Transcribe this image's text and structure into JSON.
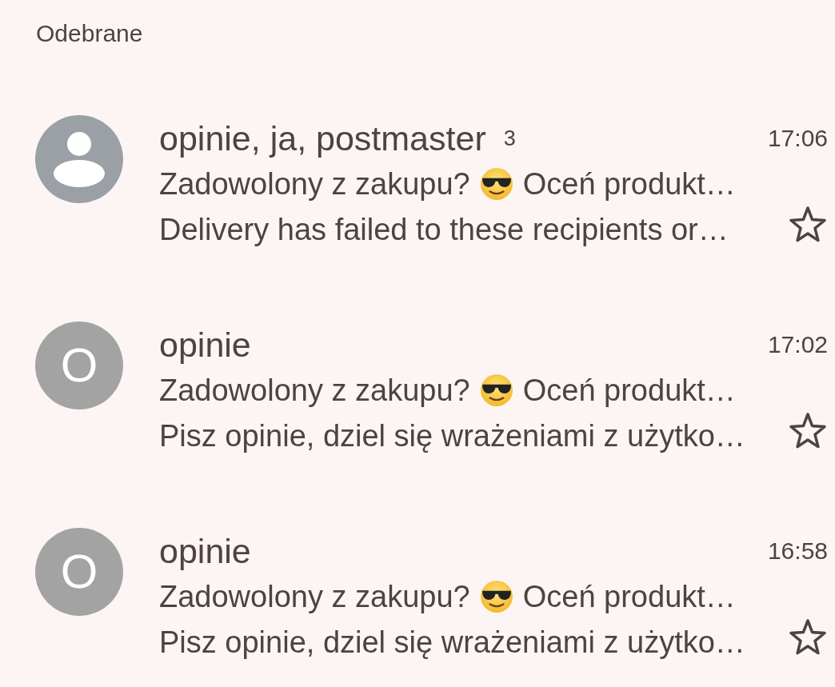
{
  "header": {
    "title": "Odebrane"
  },
  "emails": [
    {
      "avatar": {
        "kind": "person",
        "color": "#9aa0a6"
      },
      "sender": "opinie, ja, postmaster",
      "count": "3",
      "time": "17:06",
      "subject_parts": [
        "Zadowolony z zakupu?",
        "Oceń produkt…"
      ],
      "snippet": "Delivery has failed to these recipients or…",
      "starred": false
    },
    {
      "avatar": {
        "kind": "letter",
        "letter": "O",
        "color": "#a3a3a3"
      },
      "sender": "opinie",
      "time": "17:02",
      "subject_parts": [
        "Zadowolony z zakupu?",
        "Oceń produkt…"
      ],
      "snippet": "Pisz opinie, dziel się wrażeniami z użytko…",
      "starred": false
    },
    {
      "avatar": {
        "kind": "letter",
        "letter": "O",
        "color": "#a3a3a3"
      },
      "sender": "opinie",
      "time": "16:58",
      "subject_parts": [
        "Zadowolony z zakupu?",
        "Oceń produkt…"
      ],
      "snippet": "Pisz opinie, dziel się wrażeniami z użytko…",
      "starred": false
    }
  ]
}
